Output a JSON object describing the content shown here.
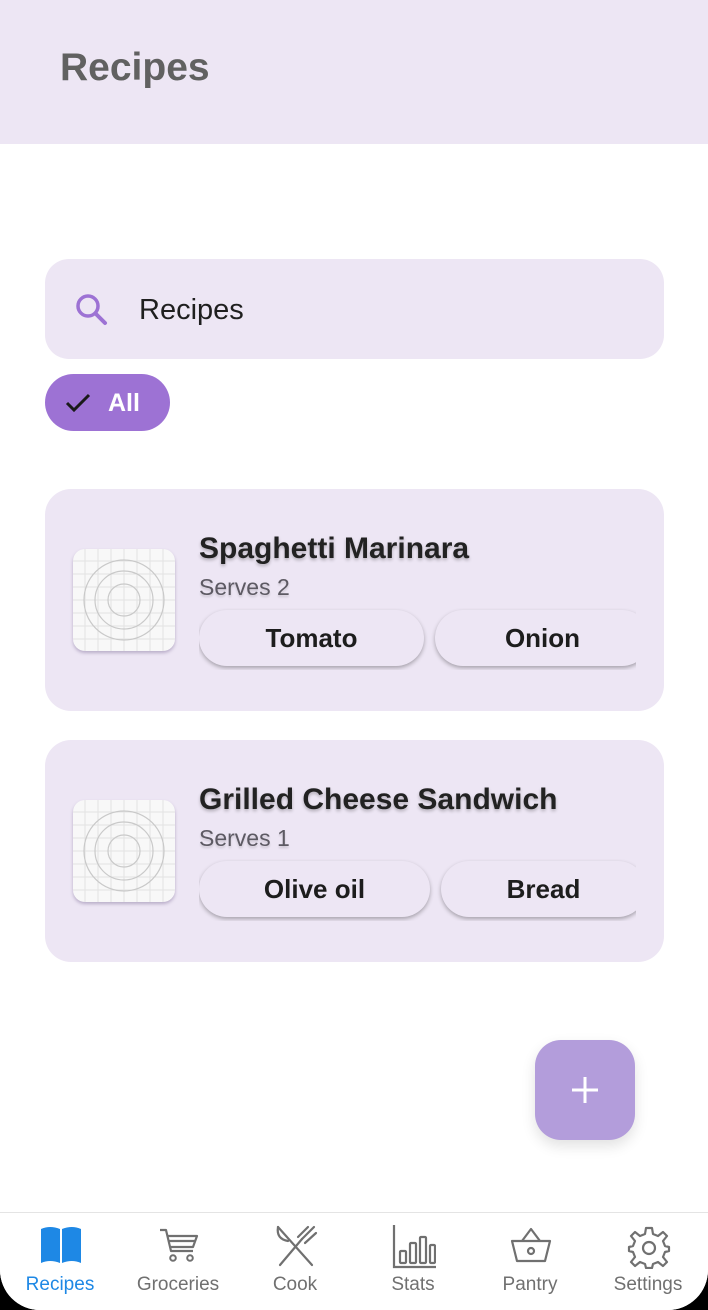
{
  "app": {
    "title": "Recipes"
  },
  "search": {
    "text": "Recipes"
  },
  "filter": {
    "chip_label": "All",
    "selected": true
  },
  "recipes": [
    {
      "title": "Spaghetti Marinara",
      "serves": "Serves 2",
      "ingredients": [
        "Tomato",
        "Onion"
      ]
    },
    {
      "title": "Grilled Cheese Sandwich",
      "serves": "Serves 1",
      "ingredients": [
        "Olive oil",
        "Bread"
      ]
    }
  ],
  "fab": {
    "icon": "plus-icon"
  },
  "nav": {
    "items": [
      {
        "label": "Recipes",
        "icon": "book-icon",
        "active": true
      },
      {
        "label": "Groceries",
        "icon": "cart-icon",
        "active": false
      },
      {
        "label": "Cook",
        "icon": "utensils-icon",
        "active": false
      },
      {
        "label": "Stats",
        "icon": "bar-chart-icon",
        "active": false
      },
      {
        "label": "Pantry",
        "icon": "basket-icon",
        "active": false
      },
      {
        "label": "Settings",
        "icon": "gear-icon",
        "active": false
      }
    ]
  },
  "colors": {
    "appbar_bg": "#ede6f4",
    "chip_bg": "#9d72d4",
    "fab_bg": "#b39ddb",
    "nav_active": "#1e88e5",
    "nav_inactive": "#707070"
  }
}
